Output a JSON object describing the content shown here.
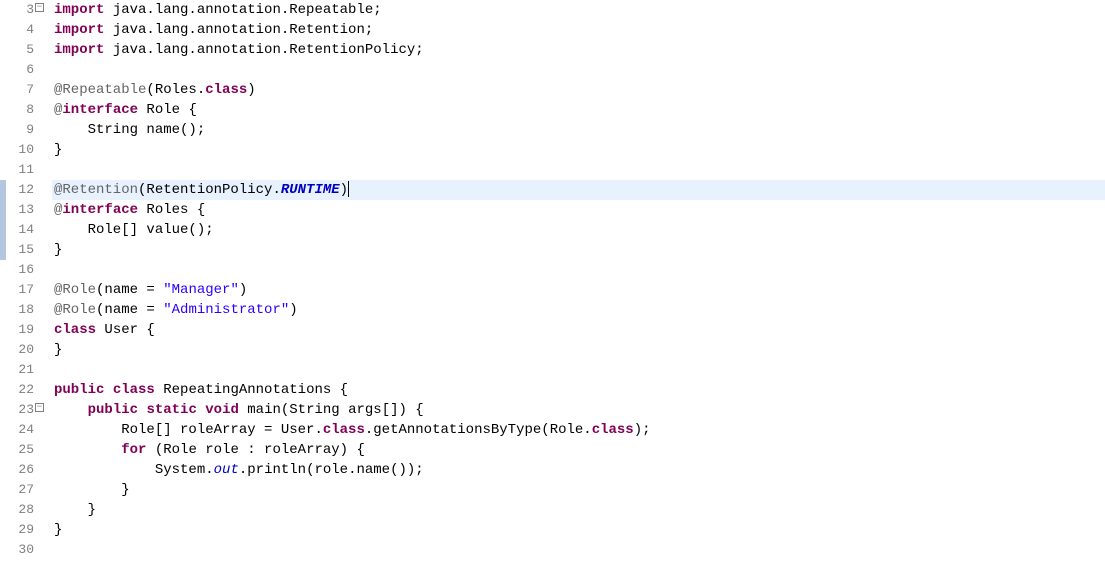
{
  "lines": [
    {
      "num": 3,
      "fold": "minus",
      "html": "<span class='kw'>import</span> java.lang.annotation.Repeatable;"
    },
    {
      "num": 4,
      "html": "<span class='kw'>import</span> java.lang.annotation.Retention;"
    },
    {
      "num": 5,
      "html": "<span class='kw'>import</span> java.lang.annotation.RetentionPolicy;"
    },
    {
      "num": 6,
      "html": ""
    },
    {
      "num": 7,
      "html": "<span class='ann'>@Repeatable</span>(Roles.<span class='kw'>class</span>)"
    },
    {
      "num": 8,
      "html": "<span class='ann'>@</span><span class='kw'>interface</span> Role {"
    },
    {
      "num": 9,
      "html": "    String name();"
    },
    {
      "num": 10,
      "html": "}"
    },
    {
      "num": 11,
      "html": ""
    },
    {
      "num": 12,
      "highlight": true,
      "marker": true,
      "caret": true,
      "html": "<span class='ann'>@Retention</span>(RetentionPolicy.<span class='const'>RUNTIME</span>)"
    },
    {
      "num": 13,
      "marker": true,
      "html": "<span class='ann'>@</span><span class='kw'>interface</span> Roles {"
    },
    {
      "num": 14,
      "marker": true,
      "html": "    Role[] value();"
    },
    {
      "num": 15,
      "marker": true,
      "html": "}"
    },
    {
      "num": 16,
      "html": ""
    },
    {
      "num": 17,
      "html": "<span class='ann'>@Role</span>(name = <span class='str'>\"Manager\"</span>)"
    },
    {
      "num": 18,
      "html": "<span class='ann'>@Role</span>(name = <span class='str'>\"Administrator\"</span>)"
    },
    {
      "num": 19,
      "html": "<span class='kw'>class</span> User {"
    },
    {
      "num": 20,
      "html": "}"
    },
    {
      "num": 21,
      "html": ""
    },
    {
      "num": 22,
      "html": "<span class='kw'>public</span> <span class='kw'>class</span> RepeatingAnnotations {"
    },
    {
      "num": 23,
      "fold": "minus",
      "html": "    <span class='kw'>public</span> <span class='kw'>static</span> <span class='kw'>void</span> main(String args[]) {"
    },
    {
      "num": 24,
      "html": "        Role[] roleArray = User.<span class='kw'>class</span>.getAnnotationsByType(Role.<span class='kw'>class</span>);"
    },
    {
      "num": 25,
      "html": "        <span class='kw'>for</span> (Role role : roleArray) {"
    },
    {
      "num": 26,
      "html": "            System.<span class='field'>out</span>.println(role.name());"
    },
    {
      "num": 27,
      "html": "        }"
    },
    {
      "num": 28,
      "html": "    }"
    },
    {
      "num": 29,
      "html": "}"
    },
    {
      "num": 30,
      "html": ""
    }
  ],
  "fold_symbol": "−"
}
